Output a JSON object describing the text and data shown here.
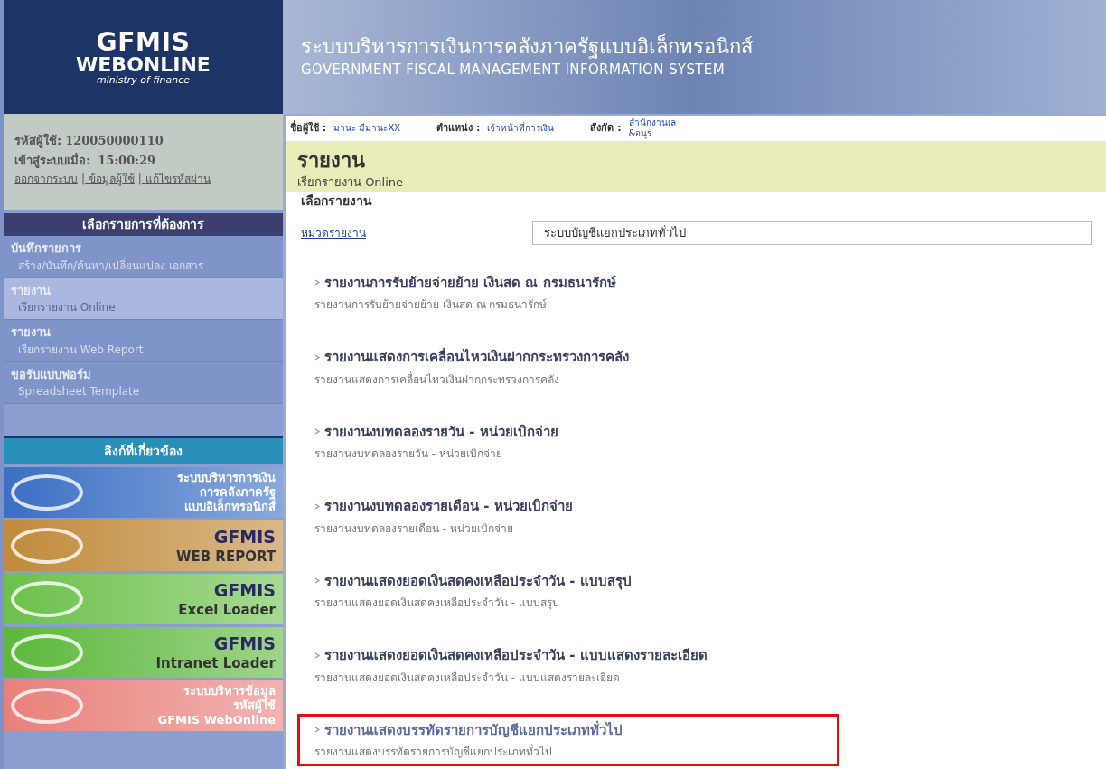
{
  "header": {
    "logo_lines": [
      "GFMIS",
      "WEBONLINE",
      "ministry of finance"
    ],
    "title_th": "ระบบบริหารการเงินการคลังภาครัฐแบบอิเล็กทรอนิกส์",
    "title_en": "GOVERNMENT FISCAL MANAGEMENT INFORMATION SYSTEM"
  },
  "user_info": {
    "user_id_label": "รหัสผู้ใช้:",
    "user_id": "120050000110",
    "login_label": "เข้าสู่ระบบเมื่อ:",
    "login_time": "15:00:29",
    "links": [
      "ออกจากระบบ",
      "| ข้อมูลผู้ใช้",
      "| แก้ไขรหัสผ่าน"
    ]
  },
  "menu": {
    "title": "เลือกรายการที่ต้องการ",
    "items": [
      {
        "label": "บันทึกรายการ",
        "sub": "สร้าง/บันทึก/ค้นหา/เปลี่ยนแปลง เอกสาร",
        "selected": false
      },
      {
        "label": "รายงาน",
        "sub": "เรียกรายงาน Online",
        "selected": true
      },
      {
        "label": "รายงาน",
        "sub": "เรียกรายงาน Web Report",
        "selected": false
      },
      {
        "label": "ขอรับแบบฟอร์ม",
        "sub": "Spreadsheet Template",
        "selected": false
      }
    ]
  },
  "related_links": {
    "title": "ลิงก์ที่เกี่ยวข้อง",
    "banners": [
      {
        "lines": [
          "ระบบบริหารการเงิน",
          "การคลังภาครัฐ",
          "แบบอิเล็กทรอนิกส์"
        ],
        "color": "#3a6fc4"
      },
      {
        "lines": [
          "GFMIS",
          "WEB REPORT"
        ],
        "color": "#c08a3a"
      },
      {
        "lines": [
          "GFMIS",
          "Excel Loader"
        ],
        "color": "#6cc04a"
      },
      {
        "lines": [
          "GFMIS",
          "Intranet Loader"
        ],
        "color": "#5cb83c"
      },
      {
        "lines": [
          "ระบบบริหารข้อมูล",
          "รหัสผู้ใช้",
          "GFMIS WebOnline"
        ],
        "color": "#e8807a"
      }
    ]
  },
  "user_bar": [
    {
      "label": "ชื่อผู้ใช้ :",
      "value": "มานะ มีมานะXX"
    },
    {
      "label": "ตำแหน่ง :",
      "value": "เจ้าหน้าที่การเงิน"
    },
    {
      "label": "สังกัด :",
      "value": "สำนักงานเล\n&อนุร"
    }
  ],
  "page": {
    "title": "รายงาน",
    "subtitle": "เรียกรายงาน Online",
    "section": "เลือกรายงาน",
    "category_label": "หมวดรายงาน",
    "category_value": "ระบบบัญชีแยกประเภททั่วไป"
  },
  "reports": [
    {
      "title": "รายงานการรับย้ายจ่ายย้าย เงินสด ณ กรมธนารักษ์",
      "desc": "รายงานการรับย้ายจ่ายย้าย เงินสด ณ กรมธนารักษ์",
      "highlighted": false
    },
    {
      "title": "รายงานแสดงการเคลื่อนไหวเงินฝากกระทรวงการคลัง",
      "desc": "รายงานแสดงการเคลื่อนไหวเงินฝากกระทรวงการคลัง",
      "highlighted": false
    },
    {
      "title": "รายงานงบทดลองรายวัน - หน่วยเบิกจ่าย",
      "desc": "รายงานงบทดลองรายวัน - หน่วยเบิกจ่าย",
      "highlighted": false
    },
    {
      "title": "รายงานงบทดลองรายเดือน - หน่วยเบิกจ่าย",
      "desc": "รายงานงบทดลองรายเดือน - หน่วยเบิกจ่าย",
      "highlighted": false
    },
    {
      "title": "รายงานแสดงยอดเงินสดคงเหลือประจำวัน - แบบสรุป",
      "desc": "รายงานแสดงยอดเงินสดคงเหลือประจำวัน - แบบสรุป",
      "highlighted": false
    },
    {
      "title": "รายงานแสดงยอดเงินสดคงเหลือประจำวัน - แบบแสดงรายละเอียด",
      "desc": "รายงานแสดงยอดเงินสดคงเหลือประจำวัน - แบบแสดงรายละเอียด",
      "highlighted": false
    },
    {
      "title": "รายงานแสดงบรรทัดรายการบัญชีแยกประเภททั่วไป",
      "desc": "รายงานแสดงบรรทัดรายการบัญชีแยกประเภททั่วไป",
      "highlighted": true
    }
  ]
}
